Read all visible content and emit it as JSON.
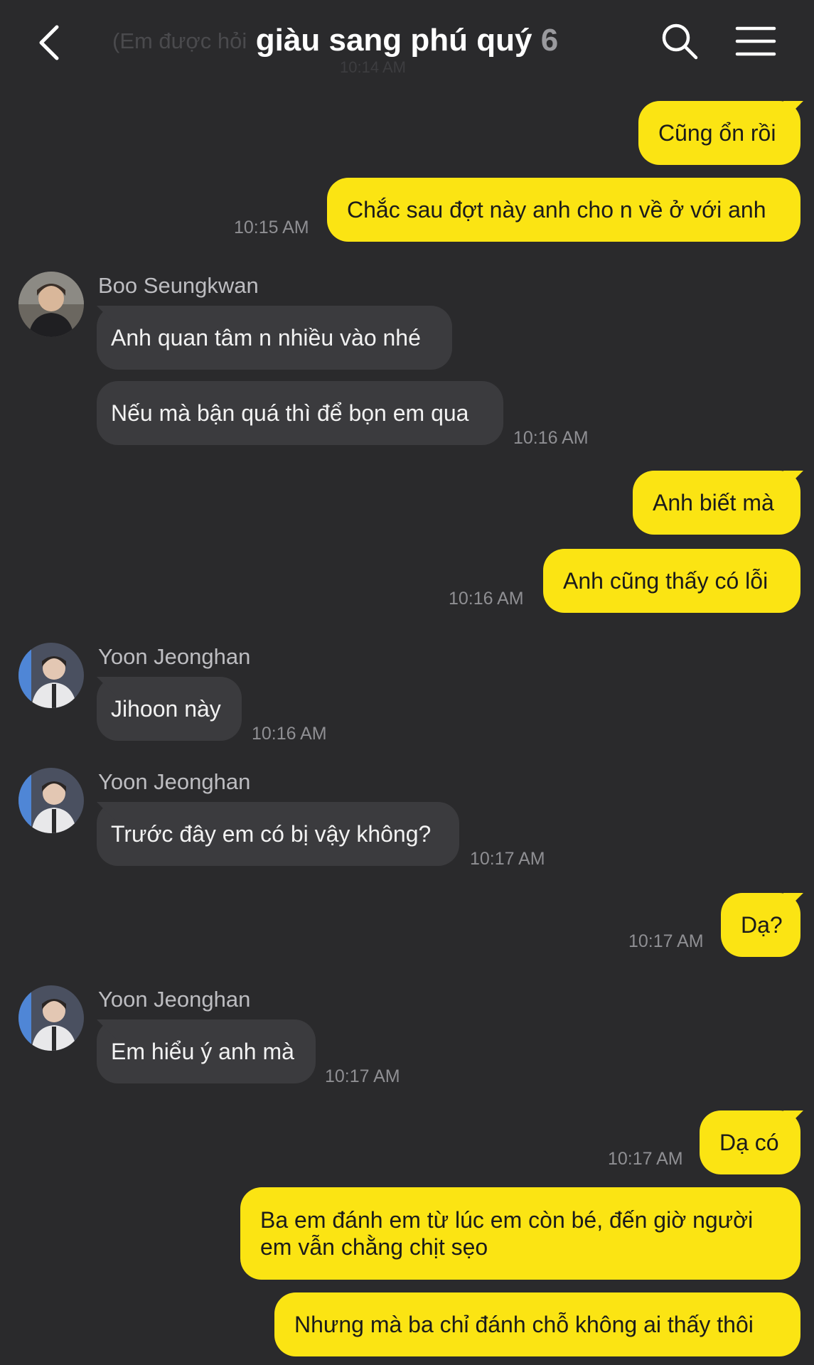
{
  "header": {
    "title": "giàu sang phú quý",
    "member_count": "6",
    "behind_text": "(Em được hỏi",
    "behind_time": "10:14 AM",
    "back_icon": "chevron-left-icon",
    "search_icon": "search-icon",
    "menu_icon": "hamburger-menu-icon"
  },
  "colors": {
    "background": "#2a2a2c",
    "my_bubble": "#fbe413",
    "their_bubble": "#3b3b3e",
    "timestamp": "#8f8f93"
  },
  "messages": [
    {
      "text": "Cũng ổn rồi"
    },
    {
      "text": "Chắc sau đợt này anh cho n về ở với anh",
      "time": "10:15 AM"
    },
    {
      "sender": "Boo Seungkwan",
      "text": "Anh quan tâm n nhiều vào nhé"
    },
    {
      "text": "Nếu mà bận quá thì để bọn em qua",
      "time": "10:16 AM"
    },
    {
      "text": "Anh biết mà"
    },
    {
      "text": "Anh cũng thấy có lỗi",
      "time": "10:16 AM"
    },
    {
      "sender": "Yoon Jeonghan",
      "text": "Jihoon này",
      "time": "10:16 AM"
    },
    {
      "sender": "Yoon Jeonghan",
      "text": "Trước đây em có bị vậy không?",
      "time": "10:17 AM"
    },
    {
      "text": "Dạ?",
      "time": "10:17 AM"
    },
    {
      "sender": "Yoon Jeonghan",
      "text": "Em hiểu ý anh mà",
      "time": "10:17 AM"
    },
    {
      "text": "Dạ có",
      "time": "10:17 AM"
    },
    {
      "text": "Ba em đánh em từ lúc em còn bé, đến giờ người em vẫn chằng chịt sẹo"
    },
    {
      "text": "Nhưng mà ba chỉ đánh chỗ không ai thấy thôi"
    }
  ]
}
